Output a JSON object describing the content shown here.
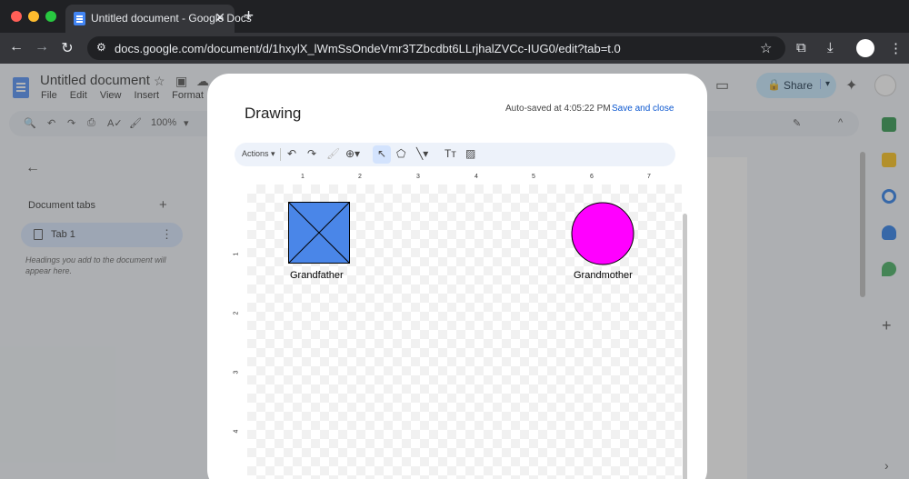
{
  "browser": {
    "tab_title": "Untitled document - Google Docs",
    "tab_close": "✕",
    "new_tab": "+",
    "url": "docs.google.com/document/d/1hxylX_lWmSsOndeVmr3TZbcdbt6LLrjhalZVCc-IUG0/edit?tab=t.0",
    "back": "←",
    "forward": "→",
    "reload": "↻",
    "site_info": "⚙",
    "star": "☆",
    "cast": "⧉",
    "download": "⤓",
    "menu": "⋮"
  },
  "docs": {
    "title": "Untitled document",
    "menus": [
      "File",
      "Edit",
      "View",
      "Insert",
      "Format"
    ],
    "zoom": "100%",
    "share_label": "Share",
    "share_caret": "▾",
    "lock": "🔒",
    "star": "☆",
    "folder": "▣",
    "cloud": "☁",
    "meet": "▭",
    "gemini": "✦",
    "search_icon": "🔍",
    "undo": "↶",
    "redo": "↷",
    "print": "⎙",
    "spell": "A✓",
    "paint": "🖌",
    "zoom_caret": "▾",
    "edit_mode": "✎",
    "collapse": "^",
    "sidebar": {
      "back": "←",
      "doc_tabs_label": "Document tabs",
      "add": "+",
      "tab1_label": "Tab 1",
      "tab1_more": "⋮",
      "hint": "Headings you add to the document will appear here."
    },
    "rail_plus": "+",
    "rail_more": "›"
  },
  "dialog": {
    "title": "Drawing",
    "autosave": "Auto-saved at 4:05:22 PM",
    "save_close": "Save and close",
    "toolbar": {
      "actions": "Actions ▾",
      "undo": "↶",
      "redo": "↷",
      "paint": "🖌",
      "zoom": "⊕▾",
      "select": "↖",
      "shape": "⬠",
      "line": "╲▾",
      "text": "Tт",
      "image": "▨"
    },
    "ruler_top": [
      "1",
      "2",
      "3",
      "4",
      "5",
      "6",
      "7"
    ],
    "ruler_left": [
      "1",
      "2",
      "3",
      "4"
    ],
    "shapes": {
      "square_label": "Grandfather",
      "square_color": "#4a86e8",
      "circle_label": "Grandmother",
      "circle_color": "#ff00ff"
    }
  }
}
